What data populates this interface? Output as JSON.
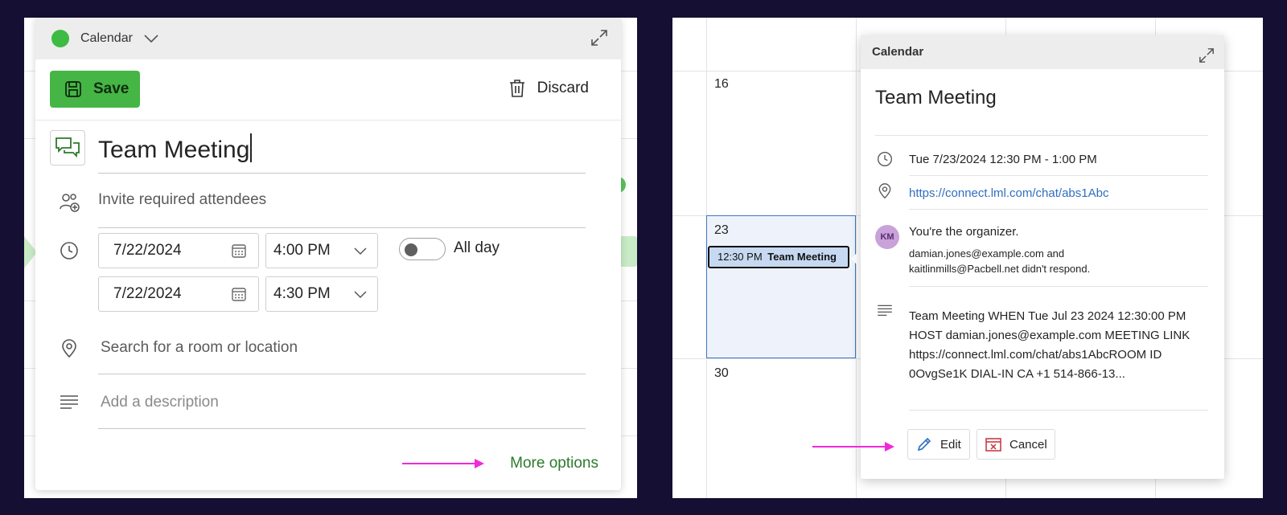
{
  "composer": {
    "calendar_name": "Calendar",
    "calendar_color": "#3dbb43",
    "save_label": "Save",
    "discard_label": "Discard",
    "title": "Team Meeting",
    "attendees_placeholder": "Invite required attendees",
    "start_date": "7/22/2024",
    "start_time": "4:00 PM",
    "end_date": "7/22/2024",
    "end_time": "4:30 PM",
    "all_day_label": "All day",
    "all_day_on": false,
    "location_placeholder": "Search for a room or location",
    "description_placeholder": "Add a description",
    "more_options_label": "More options"
  },
  "calendar_grid": {
    "days": [
      "16",
      "23",
      "30"
    ],
    "event": {
      "time": "12:30 PM",
      "title": "Team Meeting"
    }
  },
  "peek": {
    "header": "Calendar",
    "title": "Team Meeting",
    "datetime": "Tue 7/23/2024 12:30 PM - 1:00 PM",
    "link": "https://connect.lml.com/chat/abs1Abc",
    "avatar_initials": "KM",
    "organizer_text": "You're the organizer.",
    "response_line1": "damian.jones@example.com and",
    "response_line2": "kaitlinmills@Pacbell.net didn't respond.",
    "description": "Team Meeting WHEN Tue Jul 23 2024 12:30:00 PM HOST damian.jones@example.com MEETING LINK",
    "description_more": "https://connect.lml.com/chat/abs1AbcROOM ID 0OvgSe1K DIAL-IN CA +1 514-866-13...",
    "edit_label": "Edit",
    "cancel_label": "Cancel"
  },
  "colors": {
    "background": "#140f33",
    "accent_green": "#45b545",
    "arrow_pink": "#f02ad9",
    "link_blue": "#2f6fc1"
  },
  "icons": [
    "calendar-dot-icon",
    "chevron-down-icon",
    "expand-icon",
    "save-icon",
    "trash-icon",
    "chat-icon",
    "add-people-icon",
    "clock-icon",
    "calendar-icon",
    "location-icon",
    "description-icon",
    "pencil-icon",
    "cancel-calendar-icon"
  ]
}
